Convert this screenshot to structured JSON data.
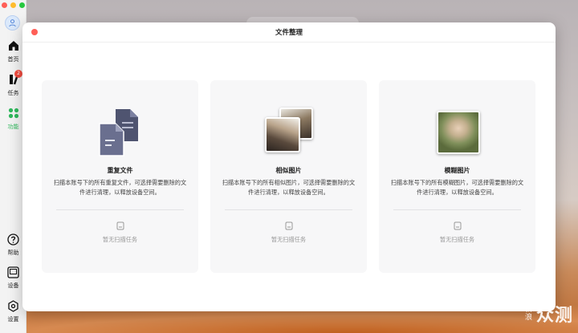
{
  "window": {
    "title": "文件整理"
  },
  "sidebar": {
    "items": [
      {
        "label": "首页",
        "icon": "home-icon"
      },
      {
        "label": "任务",
        "icon": "tasks-icon",
        "badge": "2"
      },
      {
        "label": "功能",
        "icon": "features-icon",
        "active": true
      },
      {
        "label": "帮助",
        "icon": "help-icon"
      },
      {
        "label": "设备",
        "icon": "device-icon"
      },
      {
        "label": "设置",
        "icon": "settings-icon"
      }
    ]
  },
  "cards": [
    {
      "title": "重复文件",
      "description": "扫描本账号下的所有重复文件，可选择需要删除的文件进行清理，以释放设备空间。",
      "status": "暂无扫描任务",
      "icon": "duplicate-files-icon"
    },
    {
      "title": "相似图片",
      "description": "扫描本账号下的所有相似图片，可选择需要删除的文件进行清理，以释放设备空间。",
      "status": "暂无扫描任务",
      "icon": "similar-images-icon"
    },
    {
      "title": "模糊图片",
      "description": "扫描本账号下的所有模糊图片，可选择需要删除的文件进行清理，以释放设备空间。",
      "status": "暂无扫描任务",
      "icon": "blurry-image-icon"
    }
  ],
  "watermark": {
    "big": "众测",
    "small_top": "新",
    "small_bottom": "浪"
  },
  "colors": {
    "accent_green": "#2fb85c",
    "badge_red": "#f24b3f",
    "card_bg": "#f7f7f8"
  }
}
